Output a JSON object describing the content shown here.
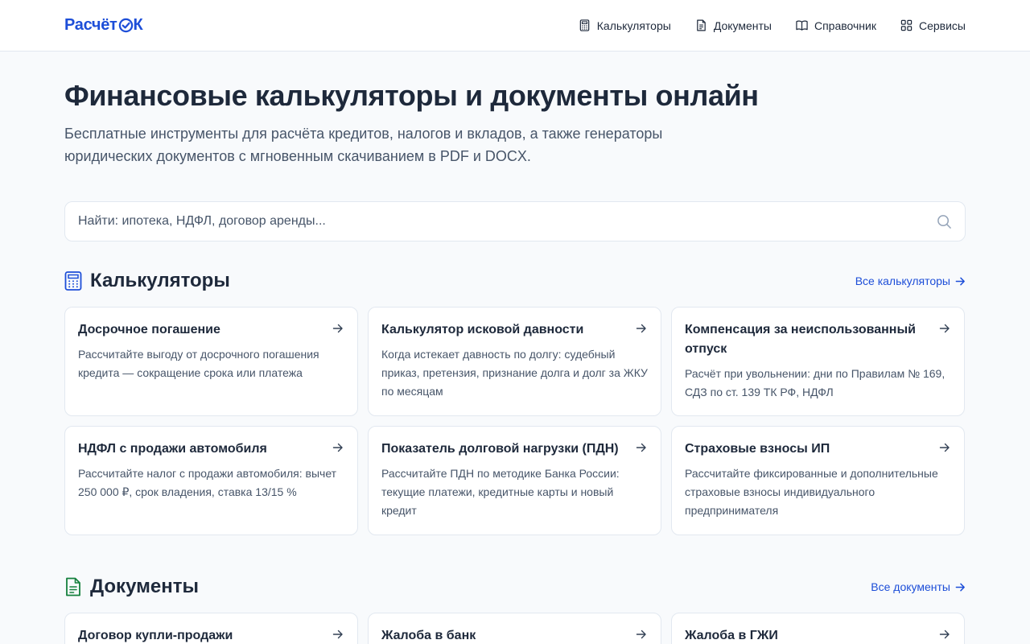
{
  "header": {
    "logo_prefix": "Расчёт",
    "logo_suffix": "К",
    "nav": [
      {
        "label": "Калькуляторы",
        "icon": "calculator-icon"
      },
      {
        "label": "Документы",
        "icon": "document-icon"
      },
      {
        "label": "Справочник",
        "icon": "book-icon"
      },
      {
        "label": "Сервисы",
        "icon": "grid-icon"
      }
    ]
  },
  "hero": {
    "title": "Финансовые калькуляторы и документы онлайн",
    "subtitle": "Бесплатные инструменты для расчёта кредитов, налогов и вкладов, а также генераторы юридических документов с мгновенным скачиванием в PDF и DOCX."
  },
  "search": {
    "placeholder": "Найти: ипотека, НДФЛ, договор аренды..."
  },
  "calculators": {
    "title": "Калькуляторы",
    "link": "Все калькуляторы",
    "cards": [
      {
        "title": "Досрочное погашение",
        "desc": "Рассчитайте выгоду от досрочного погашения кредита — сокращение срока или платежа"
      },
      {
        "title": "Калькулятор исковой давности",
        "desc": "Когда истекает давность по долгу: судебный приказ, претензия, признание долга и долг за ЖКУ по месяцам"
      },
      {
        "title": "Компенсация за неиспользованный отпуск",
        "desc": "Расчёт при увольнении: дни по Правилам № 169, СДЗ по ст. 139 ТК РФ, НДФЛ"
      },
      {
        "title": "НДФЛ с продажи автомобиля",
        "desc": "Рассчитайте налог с продажи автомобиля: вычет 250 000 ₽, срок владения, ставка 13/15 %"
      },
      {
        "title": "Показатель долговой нагрузки (ПДН)",
        "desc": "Рассчитайте ПДН по методике Банка России: текущие платежи, кредитные карты и новый кредит"
      },
      {
        "title": "Страховые взносы ИП",
        "desc": "Рассчитайте фиксированные и дополнительные страховые взносы индивидуального предпринимателя"
      }
    ]
  },
  "documents": {
    "title": "Документы",
    "link": "Все документы",
    "cards": [
      {
        "title": "Договор купли-продажи"
      },
      {
        "title": "Жалоба в банк"
      },
      {
        "title": "Жалоба в ГЖИ"
      }
    ]
  },
  "colors": {
    "brand": "#1d4ed8",
    "documents_accent": "#15803d",
    "background": "#f8fafc"
  }
}
